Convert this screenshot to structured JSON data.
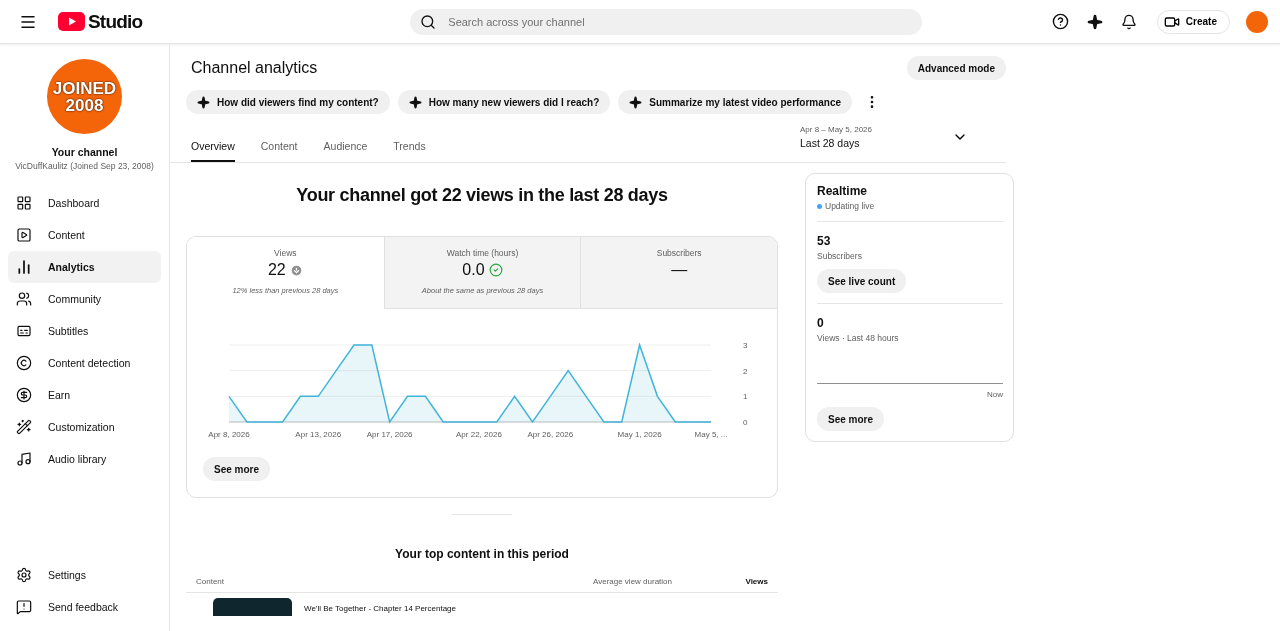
{
  "header": {
    "title": "Studio",
    "search": {
      "placeholder": "Search across your channel"
    },
    "create_button": "Create"
  },
  "sidebar": {
    "avatar_lines": [
      "JOINED",
      "2008"
    ],
    "channel_label": "Your channel",
    "channel_name": "VicDuffKaulitz (Joined Sep 23, 2008)",
    "items": [
      {
        "label": "Dashboard",
        "selected": false
      },
      {
        "label": "Content",
        "selected": false
      },
      {
        "label": "Analytics",
        "selected": true
      },
      {
        "label": "Community",
        "selected": false
      },
      {
        "label": "Subtitles",
        "selected": false
      },
      {
        "label": "Content detection",
        "selected": false
      },
      {
        "label": "Earn",
        "selected": false
      },
      {
        "label": "Customization",
        "selected": false
      },
      {
        "label": "Audio library",
        "selected": false
      }
    ],
    "footer_items": [
      "Settings",
      "Send feedback"
    ]
  },
  "page": {
    "title": "Channel analytics",
    "advanced_button": "Advanced mode",
    "prompts": [
      "How did viewers find my content?",
      "How many new viewers did I reach?",
      "Summarize my latest video performance"
    ],
    "tabs": [
      {
        "label": "Overview",
        "selected": true
      },
      {
        "label": "Content",
        "selected": false
      },
      {
        "label": "Audience",
        "selected": false
      },
      {
        "label": "Trends",
        "selected": false
      }
    ],
    "date_range": {
      "range": "Apr 8 – May 5, 2026",
      "label": "Last 28 days"
    }
  },
  "overview": {
    "headline": "Your channel got 22 views in the last 28 days",
    "metrics": [
      {
        "label": "Views",
        "value": "22",
        "kind": "down",
        "note": "12% less than previous 28 days",
        "selected": true
      },
      {
        "label": "Watch time (hours)",
        "value": "0.0",
        "kind": "same",
        "note": "About the same as previous 28 days",
        "selected": false
      },
      {
        "label": "Subscribers",
        "value": "—",
        "kind": "plain",
        "selected": false
      }
    ],
    "chart_data": {
      "type": "area",
      "categories": [
        "Apr 8, 2026",
        null,
        null,
        null,
        null,
        "Apr 13, 2026",
        null,
        null,
        null,
        "Apr 17, 2026",
        null,
        null,
        null,
        null,
        "Apr 22, 2026",
        null,
        null,
        null,
        "Apr 26, 2026",
        null,
        null,
        null,
        null,
        "May 1, 2026",
        null,
        null,
        null,
        "May 5, ..."
      ],
      "series": [
        {
          "color": "#41b4d9",
          "values": [
            1,
            0,
            0,
            0,
            1,
            1,
            2,
            3,
            3,
            0,
            1,
            1,
            0,
            0,
            0,
            0,
            1,
            0,
            1,
            2,
            1,
            0,
            0,
            3,
            1,
            0,
            0,
            0
          ]
        }
      ],
      "ylim": [
        0,
        3
      ],
      "yticks": [
        0,
        1,
        2,
        3
      ]
    },
    "see_more": "See more"
  },
  "realtime": {
    "title": "Realtime",
    "status": "Updating live",
    "subscribers": {
      "value": "53",
      "label": "Subscribers",
      "button": "See live count"
    },
    "views": {
      "value": "0",
      "label": "Views · Last 48 hours",
      "axis_label": "Now"
    },
    "see_more": "See more"
  },
  "top_content": {
    "heading": "Your top content in this period",
    "columns": [
      "Content",
      "Average view duration",
      "Views"
    ],
    "rows": [
      {
        "title": "We'll Be Together - Chapter 14 Percentage"
      }
    ]
  }
}
